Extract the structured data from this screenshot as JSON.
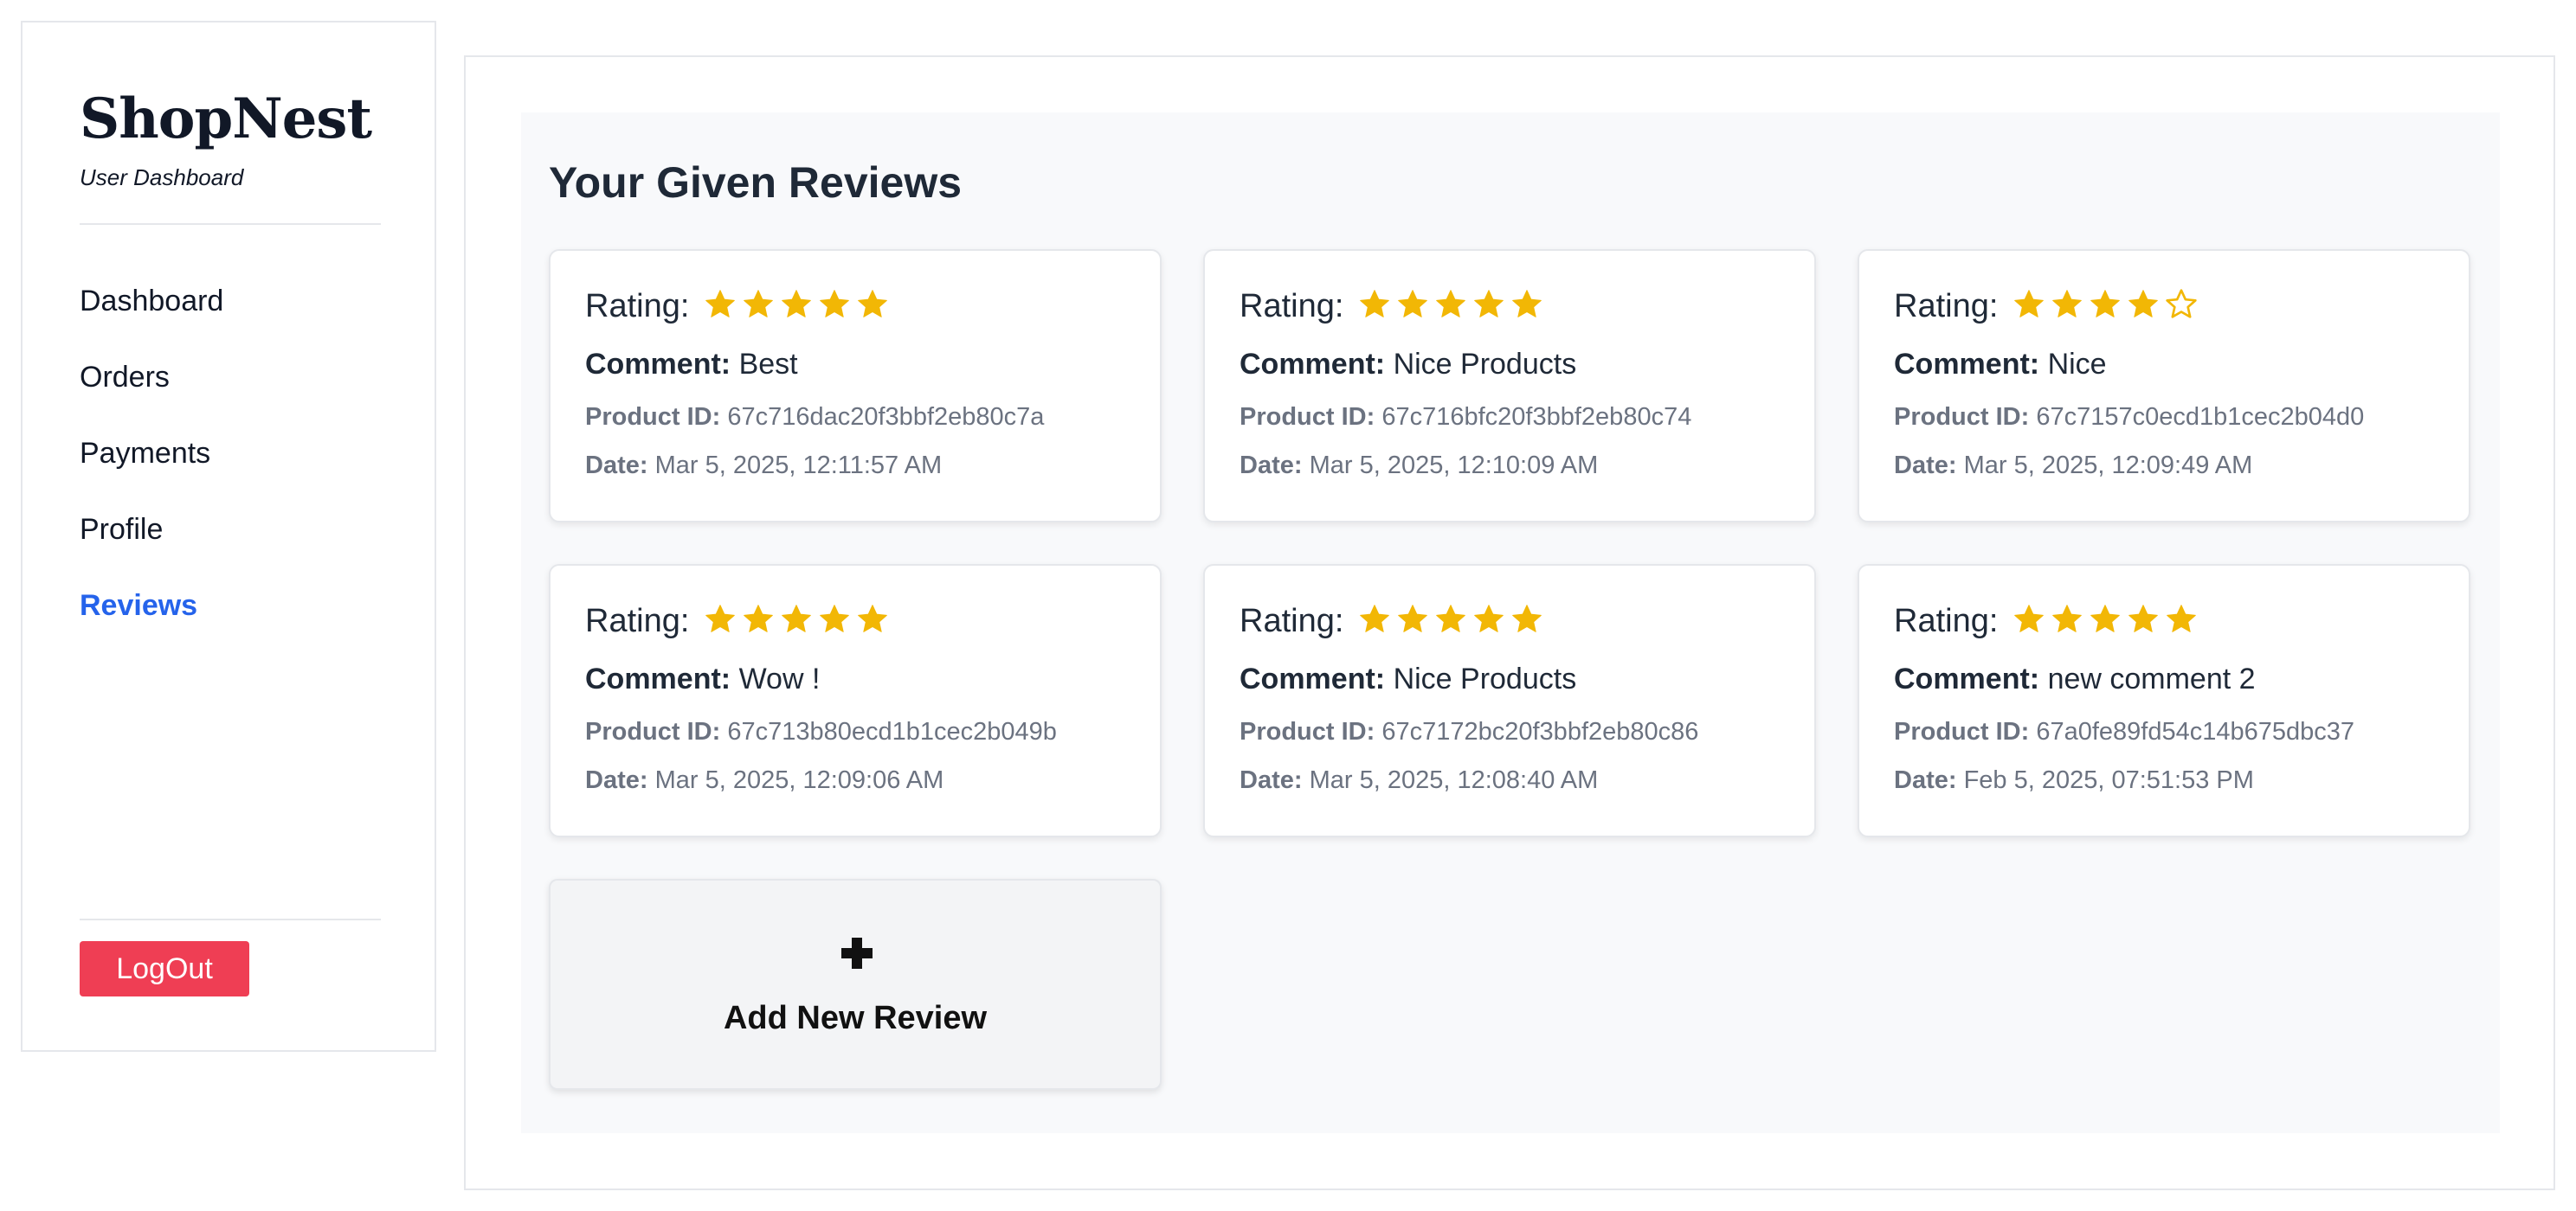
{
  "brand": {
    "title": "ShopNest",
    "subtitle": "User Dashboard"
  },
  "nav": {
    "items": [
      {
        "label": "Dashboard",
        "active": false
      },
      {
        "label": "Orders",
        "active": false
      },
      {
        "label": "Payments",
        "active": false
      },
      {
        "label": "Profile",
        "active": false
      },
      {
        "label": "Reviews",
        "active": true
      }
    ]
  },
  "logout_label": "LogOut",
  "page_title": "Your Given Reviews",
  "labels": {
    "rating": "Rating:",
    "comment": "Comment:",
    "product_id": "Product ID:",
    "date": "Date:"
  },
  "reviews": [
    {
      "rating": 5,
      "comment": "Best",
      "product_id": "67c716dac20f3bbf2eb80c7a",
      "date": "Mar 5, 2025, 12:11:57 AM"
    },
    {
      "rating": 5,
      "comment": "Nice Products",
      "product_id": "67c716bfc20f3bbf2eb80c74",
      "date": "Mar 5, 2025, 12:10:09 AM"
    },
    {
      "rating": 4,
      "comment": "Nice",
      "product_id": "67c7157c0ecd1b1cec2b04d0",
      "date": "Mar 5, 2025, 12:09:49 AM"
    },
    {
      "rating": 5,
      "comment": "Wow !",
      "product_id": "67c713b80ecd1b1cec2b049b",
      "date": "Mar 5, 2025, 12:09:06 AM"
    },
    {
      "rating": 5,
      "comment": "Nice Products",
      "product_id": "67c7172bc20f3bbf2eb80c86",
      "date": "Mar 5, 2025, 12:08:40 AM"
    },
    {
      "rating": 5,
      "comment": "new comment 2",
      "product_id": "67a0fe89fd54c14b675dbc37",
      "date": "Feb 5, 2025, 07:51:53 PM"
    }
  ],
  "add_review": {
    "label": "Add New Review",
    "icon": "plus-icon"
  },
  "colors": {
    "accent": "#2563eb",
    "star": "#f2b705",
    "logout": "#ef3e54"
  }
}
